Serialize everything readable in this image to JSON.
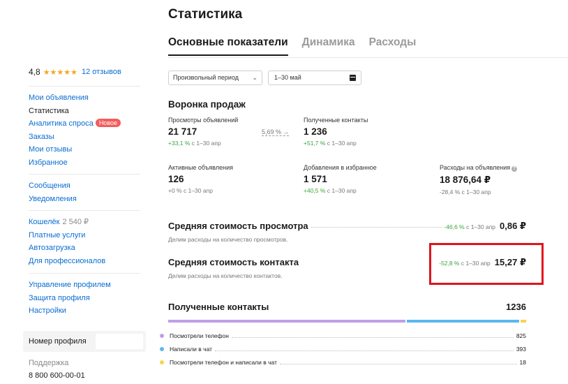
{
  "sidebar": {
    "rating": {
      "score": "4,8",
      "stars": "★★★★★",
      "reviews": "12 отзывов"
    },
    "group1": [
      {
        "label": "Мои объявления",
        "active": false
      },
      {
        "label": "Статистика",
        "active": true
      },
      {
        "label": "Аналитика спроса",
        "badge": "Новое",
        "active": false
      },
      {
        "label": "Заказы",
        "active": false
      },
      {
        "label": "Мои отзывы",
        "active": false
      },
      {
        "label": "Избранное",
        "active": false
      }
    ],
    "group2": [
      {
        "label": "Сообщения"
      },
      {
        "label": "Уведомления"
      }
    ],
    "group3": [
      {
        "label": "Кошелёк",
        "value": "2 540 ₽"
      },
      {
        "label": "Платные услуги"
      },
      {
        "label": "Автозагрузка"
      },
      {
        "label": "Для профессионалов"
      }
    ],
    "group4": [
      {
        "label": "Управление профилем"
      },
      {
        "label": "Защита профиля"
      },
      {
        "label": "Настройки"
      }
    ],
    "profile_number_label": "Номер профиля",
    "support_label": "Поддержка",
    "support_phone": "8 800 600-00-01"
  },
  "main": {
    "title": "Статистика",
    "tabs": [
      "Основные показатели",
      "Динамика",
      "Расходы"
    ],
    "period_select": "Произвольный период",
    "date_range": "1–30 май",
    "funnel_title": "Воронка продаж",
    "metrics": {
      "views": {
        "label": "Просмотры объявлений",
        "value": "21 717",
        "delta": "+33,1 %",
        "period": " с 1–30 апр"
      },
      "contacts": {
        "label": "Полученные контакты",
        "value": "1 236",
        "delta": "+51,7 %",
        "period": " с 1–30 апр"
      },
      "active": {
        "label": "Активные объявления",
        "value": "126",
        "delta": "+0 %",
        "period": " с 1–30 апр"
      },
      "favorites": {
        "label": "Добавления в избранное",
        "value": "1 571",
        "delta": "+40,5 %",
        "period": " с 1–30 апр"
      },
      "spend": {
        "label": "Расходы на объявления",
        "value": "18 876,64 ₽",
        "delta": "-28,4 %",
        "period": " с 1–30 апр"
      }
    },
    "conversion": "5,69 %",
    "cost_view": {
      "title": "Средняя стоимость просмотра",
      "desc": "Делим расходы на количество просмотров.",
      "delta": "-46,6 %",
      "period": " с 1–30 апр",
      "value": "0,86 ₽"
    },
    "cost_contact": {
      "title": "Средняя стоимость контакта",
      "desc": "Делим расходы на количество контактов.",
      "delta": "-52,8 %",
      "period": " с 1–30 апр",
      "value": "15,27 ₽"
    },
    "received": {
      "title": "Полученные контакты",
      "total": "1236",
      "rows": [
        {
          "label": "Посмотрели телефон",
          "count": "825",
          "share": 0.667,
          "color": "#c19ee8"
        },
        {
          "label": "Написали в чат",
          "count": "393",
          "share": 0.318,
          "color": "#5ab8f0"
        },
        {
          "label": "Посмотрели телефон и написали в чат",
          "count": "18",
          "share": 0.015,
          "color": "#f7d54a"
        }
      ]
    }
  }
}
